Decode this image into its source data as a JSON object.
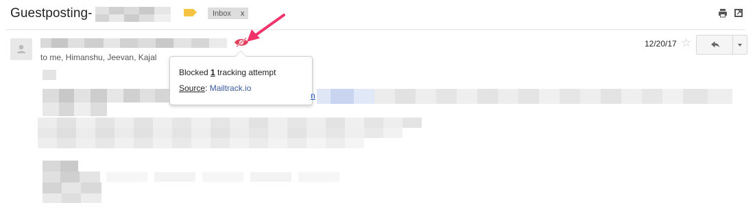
{
  "header": {
    "subject": "Guestposting-",
    "label_chip": "Inbox",
    "label_chip_close": "x",
    "label_color": "#f5c443"
  },
  "message": {
    "recipients": "to me, Himanshu, Jeevan, Kajal",
    "date": "12/20/17",
    "star_icon": "star-outline-icon",
    "reply_icon": "reply-arrow-icon",
    "more_icon": "caret-down-icon",
    "tracker_icon": "eye-crossed-icon",
    "tracker_color": "#e0405a",
    "link_fragment": "n"
  },
  "tooltip": {
    "blocked_prefix": "Blocked ",
    "blocked_count": "1",
    "blocked_suffix": " tracking attempt",
    "source_label": "Source",
    "source_sep": ": ",
    "source_link": "Mailtrack.io"
  },
  "annotation": {
    "arrow_color": "#f0336a"
  }
}
